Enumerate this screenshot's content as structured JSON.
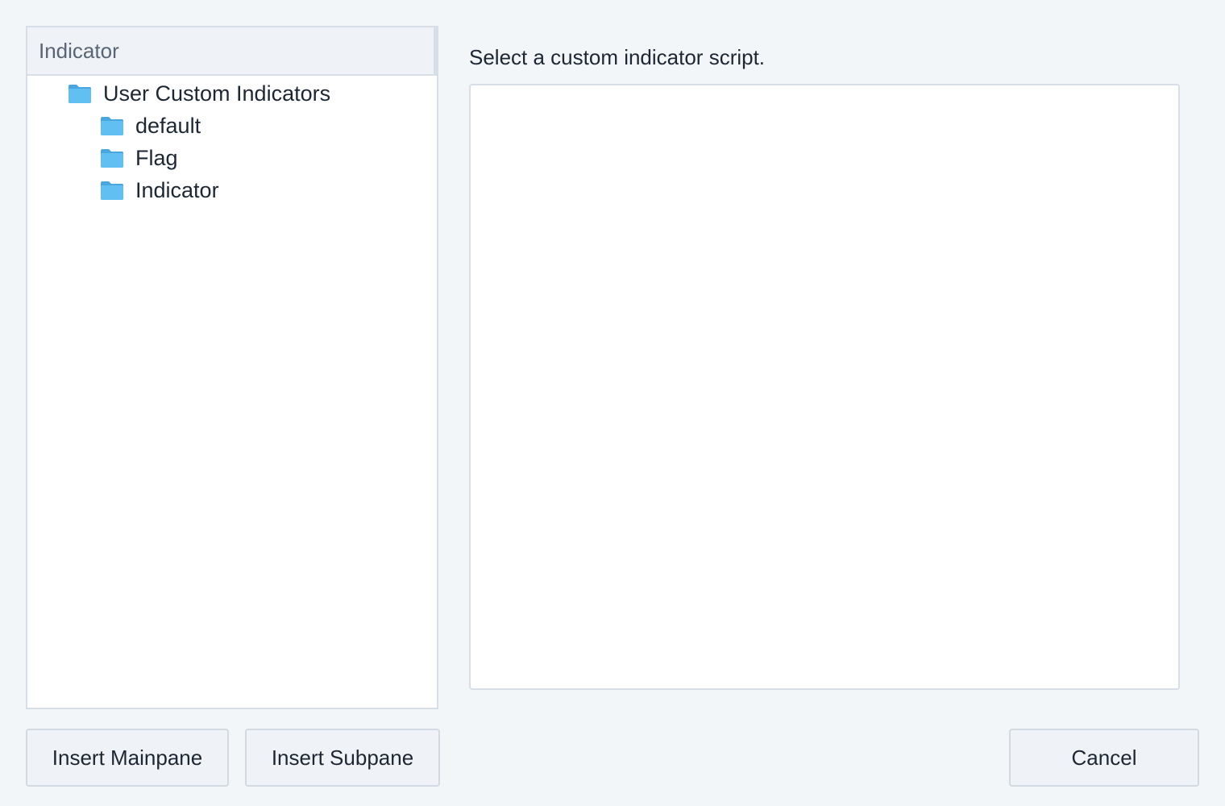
{
  "tree": {
    "header": "Indicator",
    "root": {
      "label": "User Custom Indicators",
      "icon": "folder-icon",
      "children": [
        {
          "label": "default",
          "icon": "folder-icon"
        },
        {
          "label": "Flag",
          "icon": "folder-icon"
        },
        {
          "label": "Indicator",
          "icon": "folder-icon"
        }
      ]
    }
  },
  "detail": {
    "instruction": "Select a custom indicator script."
  },
  "buttons": {
    "insert_mainpane": "Insert Mainpane",
    "insert_subpane": "Insert Subpane",
    "cancel": "Cancel"
  },
  "colors": {
    "background": "#f3f6f9",
    "folder": "#5bb8f0",
    "border": "#d8dee6"
  }
}
